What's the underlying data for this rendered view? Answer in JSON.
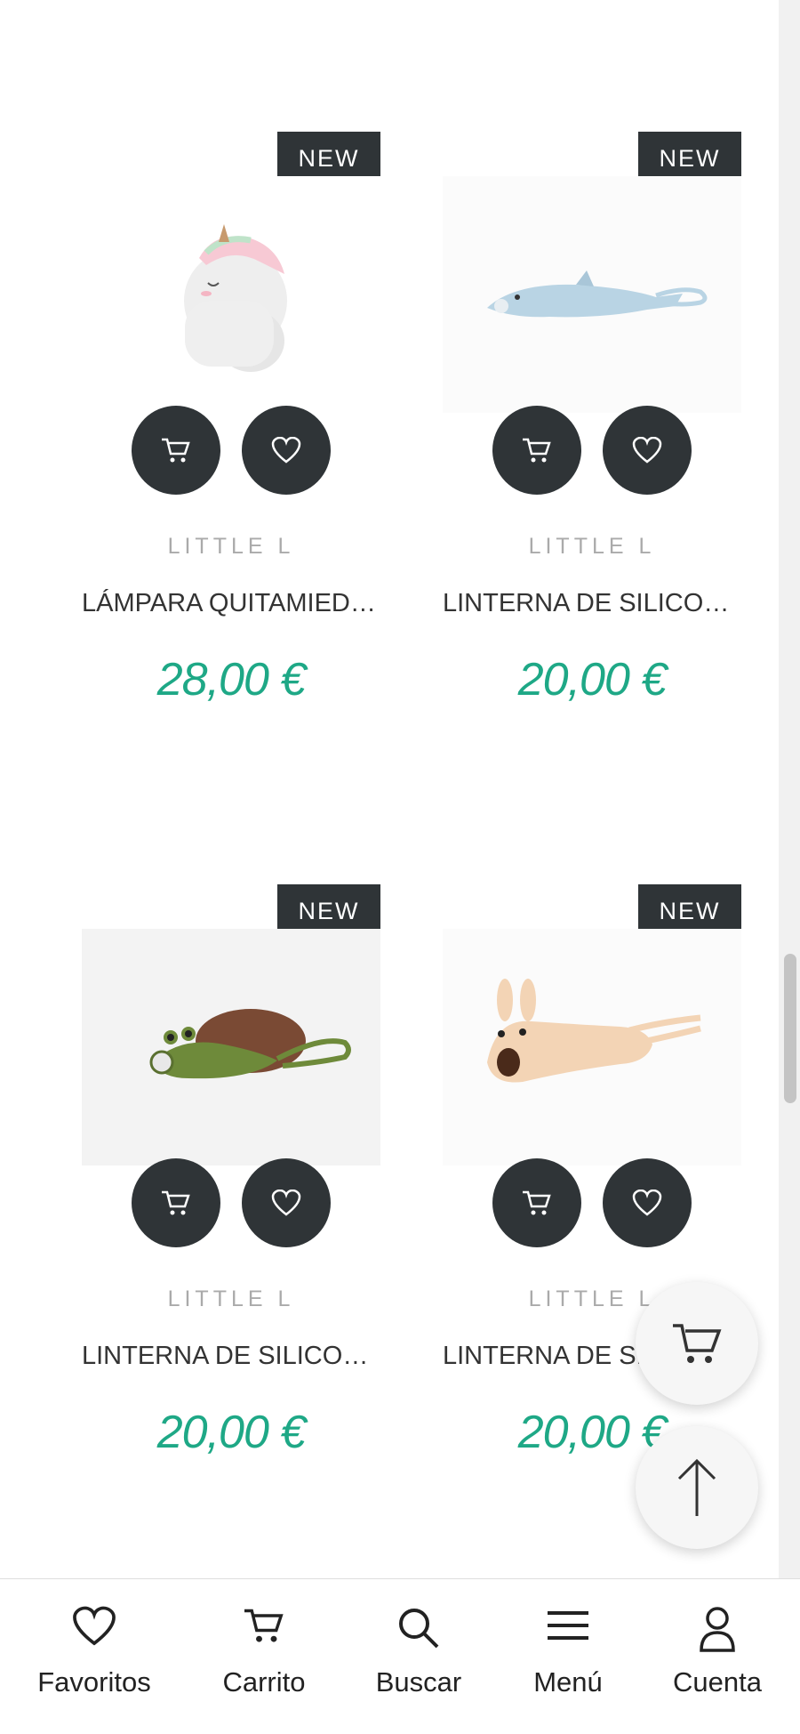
{
  "products": [
    {
      "badge": "NEW",
      "brand": "LITTLE L",
      "title": "LÁMPARA QUITAMIEDOS UNICORNIO",
      "price": "28,00 €",
      "image": "unicorn-lamp-image"
    },
    {
      "badge": "NEW",
      "brand": "LITTLE L",
      "title": "LINTERNA DE SILICONA DELFÍN",
      "price": "20,00 €",
      "image": "dolphin-flashlight-image"
    },
    {
      "badge": "NEW",
      "brand": "LITTLE L",
      "title": "LINTERNA DE SILICONA TORTUGA",
      "price": "20,00 €",
      "image": "turtle-flashlight-image"
    },
    {
      "badge": "NEW",
      "brand": "LITTLE L",
      "title": "LINTERNA DE SILICONA CONEJO",
      "price": "20,00 €",
      "image": "bunny-flashlight-image"
    }
  ],
  "floating": {
    "cart_icon": "cart-icon",
    "top_icon": "arrow-up-icon"
  },
  "nav": {
    "favorites": "Favoritos",
    "cart": "Carrito",
    "search": "Buscar",
    "menu": "Menú",
    "account": "Cuenta"
  },
  "colors": {
    "price": "#1ea886",
    "dark": "#2f3437",
    "brand": "#aaaaaa"
  }
}
